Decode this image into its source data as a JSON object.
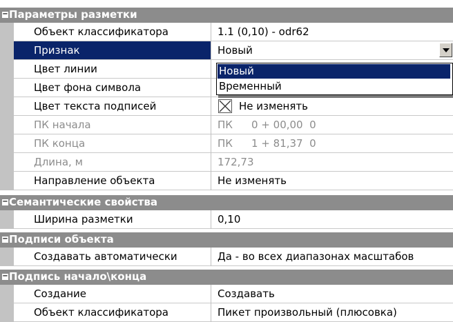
{
  "sections": {
    "markup": "Параметры разметки",
    "semantic": "Семантические свойства",
    "captions": "Подписи объекта",
    "startend": "Подпись начало\\конца"
  },
  "rows": {
    "classifier": {
      "name": "Объект классификатора",
      "value": "1.1 (0,10) - odr62"
    },
    "sign": {
      "name": "Признак",
      "value": "Новый"
    },
    "line_color": {
      "name": "Цвет линии",
      "value": ""
    },
    "symbol_bg": {
      "name": "Цвет фона символа",
      "value": ""
    },
    "text_color": {
      "name": "Цвет текста подписей",
      "value": "Не изменять"
    },
    "pk_start": {
      "name": "ПК начала",
      "pk": "ПК",
      "value": "0 + 00,00  0"
    },
    "pk_end": {
      "name": "ПК конца",
      "pk": "ПК",
      "value": "1 + 81,37  0"
    },
    "length": {
      "name": "Длина, м",
      "value": "172,73"
    },
    "direction": {
      "name": "Направление объекта",
      "value": "Не изменять"
    },
    "width": {
      "name": "Ширина разметки",
      "value": "0,10"
    },
    "auto_create": {
      "name": "Создавать автоматически",
      "value": "Да - во всех диапазонах масштабов"
    },
    "creation": {
      "name": "Создание",
      "value": "Создавать"
    },
    "classifier2": {
      "name": "Объект классификатора",
      "value": "Пикет произвольный (плюсовка)"
    }
  },
  "dropdown": {
    "options": [
      "Новый",
      "Временный"
    ],
    "selected_index": 0
  },
  "colors": {
    "section_bg": "#8c8c8c",
    "selection": "#0a246a",
    "gutter": "#c3c3c3",
    "disabled_text": "#8c8c8c"
  }
}
